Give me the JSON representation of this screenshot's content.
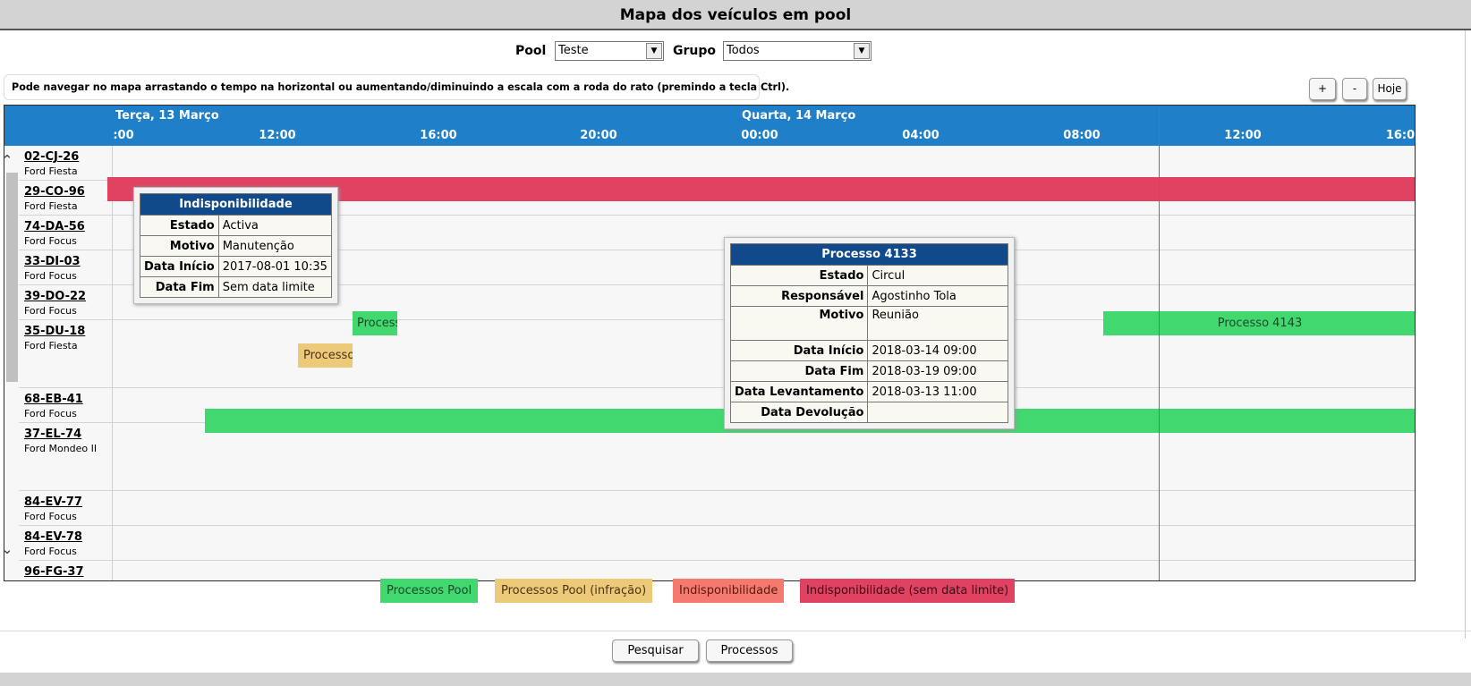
{
  "title": "Mapa dos veículos em pool",
  "filters": {
    "pool_label": "Pool",
    "pool_value": "Teste",
    "grupo_label": "Grupo",
    "grupo_value": "Todos"
  },
  "hint": "Pode navegar no mapa arrastando o tempo na horizontal ou aumentando/diminuindo a escala com a roda do rato (premindo a tecla Ctrl).",
  "zoom": {
    "plus": "+",
    "minus": "-",
    "today": "Hoje"
  },
  "timeline": {
    "day1": "Terça, 13 Março",
    "day2": "Quarta, 14 Março",
    "ticks": [
      ":00",
      "12:00",
      "16:00",
      "20:00",
      "00:00",
      "04:00",
      "08:00",
      "12:00",
      "16:0"
    ]
  },
  "vehicles": [
    {
      "plate": "02-CJ-26",
      "model": "Ford Fiesta"
    },
    {
      "plate": "29-CO-96",
      "model": "Ford Fiesta"
    },
    {
      "plate": "74-DA-56",
      "model": "Ford Focus"
    },
    {
      "plate": "33-DI-03",
      "model": "Ford Focus"
    },
    {
      "plate": "39-DO-22",
      "model": "Ford Focus"
    },
    {
      "plate": "35-DU-18",
      "model": "Ford Fiesta"
    },
    {
      "plate": "68-EB-41",
      "model": "Ford Focus"
    },
    {
      "plate": "37-EL-74",
      "model": "Ford Mondeo II"
    },
    {
      "plate": "84-EV-77",
      "model": "Ford Focus"
    },
    {
      "plate": "84-EV-78",
      "model": "Ford Focus"
    },
    {
      "plate": "96-FG-37",
      "model": ""
    }
  ],
  "bars": {
    "processo_short": "Process",
    "processo_orange": "Processo",
    "processo_4143": "Processo 4143"
  },
  "tooltip_indisp": {
    "title": "Indisponibilidade",
    "rows": [
      {
        "k": "Estado",
        "v": "Activa"
      },
      {
        "k": "Motivo",
        "v": "Manutenção"
      },
      {
        "k": "Data Início",
        "v": "2017-08-01 10:35"
      },
      {
        "k": "Data Fim",
        "v": "Sem data limite"
      }
    ]
  },
  "tooltip_proc": {
    "title": "Processo 4133",
    "rows": [
      {
        "k": "Estado",
        "v": "Circul"
      },
      {
        "k": "Responsável",
        "v": "Agostinho Tola"
      },
      {
        "k": "Motivo",
        "v": "Reunião"
      },
      {
        "k": "Data Início",
        "v": "2018-03-14 09:00"
      },
      {
        "k": "Data Fim",
        "v": "2018-03-19 09:00"
      },
      {
        "k": "Data Levantamento",
        "v": "2018-03-13 11:00"
      },
      {
        "k": "Data Devolução",
        "v": ""
      }
    ]
  },
  "legend": [
    {
      "label": "Processos Pool",
      "color": "#41d86f"
    },
    {
      "label": "Processos Pool (infração)",
      "color": "#edc97a"
    },
    {
      "label": "Indisponibilidade",
      "color": "#f47a6f"
    },
    {
      "label": "Indisponibilidade (sem data limite)",
      "color": "#e04262"
    }
  ],
  "actions": {
    "search": "Pesquisar",
    "processes": "Processos"
  }
}
